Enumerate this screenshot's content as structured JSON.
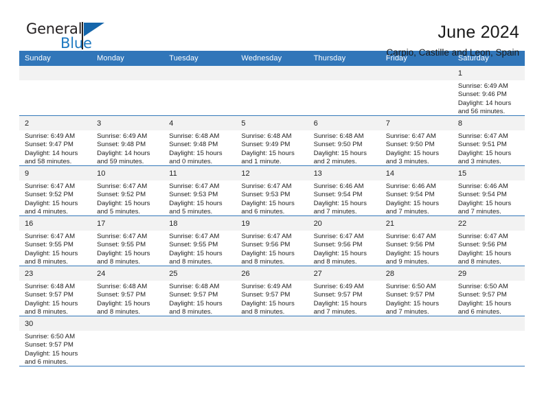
{
  "brand": {
    "name_part1": "General",
    "name_part2": "Blue",
    "flag_icon": "blue-flag-logo"
  },
  "header": {
    "title": "June 2024",
    "subtitle": "Carpio, Castille and Leon, Spain"
  },
  "calendar": {
    "weekday_headers": [
      "Sunday",
      "Monday",
      "Tuesday",
      "Wednesday",
      "Thursday",
      "Friday",
      "Saturday"
    ],
    "accent_color": "#3176b9",
    "daynum_band_color": "#f2f2f2",
    "labels": {
      "sunrise": "Sunrise:",
      "sunset": "Sunset:",
      "daylight": "Daylight:"
    },
    "weeks": [
      [
        {
          "day": "",
          "blank": true
        },
        {
          "day": "",
          "blank": true
        },
        {
          "day": "",
          "blank": true
        },
        {
          "day": "",
          "blank": true
        },
        {
          "day": "",
          "blank": true
        },
        {
          "day": "",
          "blank": true
        },
        {
          "day": "1",
          "sunrise": "Sunrise: 6:49 AM",
          "sunset": "Sunset: 9:46 PM",
          "daylight": "Daylight: 14 hours and 56 minutes."
        }
      ],
      [
        {
          "day": "2",
          "sunrise": "Sunrise: 6:49 AM",
          "sunset": "Sunset: 9:47 PM",
          "daylight": "Daylight: 14 hours and 58 minutes."
        },
        {
          "day": "3",
          "sunrise": "Sunrise: 6:49 AM",
          "sunset": "Sunset: 9:48 PM",
          "daylight": "Daylight: 14 hours and 59 minutes."
        },
        {
          "day": "4",
          "sunrise": "Sunrise: 6:48 AM",
          "sunset": "Sunset: 9:48 PM",
          "daylight": "Daylight: 15 hours and 0 minutes."
        },
        {
          "day": "5",
          "sunrise": "Sunrise: 6:48 AM",
          "sunset": "Sunset: 9:49 PM",
          "daylight": "Daylight: 15 hours and 1 minute."
        },
        {
          "day": "6",
          "sunrise": "Sunrise: 6:48 AM",
          "sunset": "Sunset: 9:50 PM",
          "daylight": "Daylight: 15 hours and 2 minutes."
        },
        {
          "day": "7",
          "sunrise": "Sunrise: 6:47 AM",
          "sunset": "Sunset: 9:50 PM",
          "daylight": "Daylight: 15 hours and 3 minutes."
        },
        {
          "day": "8",
          "sunrise": "Sunrise: 6:47 AM",
          "sunset": "Sunset: 9:51 PM",
          "daylight": "Daylight: 15 hours and 3 minutes."
        }
      ],
      [
        {
          "day": "9",
          "sunrise": "Sunrise: 6:47 AM",
          "sunset": "Sunset: 9:52 PM",
          "daylight": "Daylight: 15 hours and 4 minutes."
        },
        {
          "day": "10",
          "sunrise": "Sunrise: 6:47 AM",
          "sunset": "Sunset: 9:52 PM",
          "daylight": "Daylight: 15 hours and 5 minutes."
        },
        {
          "day": "11",
          "sunrise": "Sunrise: 6:47 AM",
          "sunset": "Sunset: 9:53 PM",
          "daylight": "Daylight: 15 hours and 5 minutes."
        },
        {
          "day": "12",
          "sunrise": "Sunrise: 6:47 AM",
          "sunset": "Sunset: 9:53 PM",
          "daylight": "Daylight: 15 hours and 6 minutes."
        },
        {
          "day": "13",
          "sunrise": "Sunrise: 6:46 AM",
          "sunset": "Sunset: 9:54 PM",
          "daylight": "Daylight: 15 hours and 7 minutes."
        },
        {
          "day": "14",
          "sunrise": "Sunrise: 6:46 AM",
          "sunset": "Sunset: 9:54 PM",
          "daylight": "Daylight: 15 hours and 7 minutes."
        },
        {
          "day": "15",
          "sunrise": "Sunrise: 6:46 AM",
          "sunset": "Sunset: 9:54 PM",
          "daylight": "Daylight: 15 hours and 7 minutes."
        }
      ],
      [
        {
          "day": "16",
          "sunrise": "Sunrise: 6:47 AM",
          "sunset": "Sunset: 9:55 PM",
          "daylight": "Daylight: 15 hours and 8 minutes."
        },
        {
          "day": "17",
          "sunrise": "Sunrise: 6:47 AM",
          "sunset": "Sunset: 9:55 PM",
          "daylight": "Daylight: 15 hours and 8 minutes."
        },
        {
          "day": "18",
          "sunrise": "Sunrise: 6:47 AM",
          "sunset": "Sunset: 9:55 PM",
          "daylight": "Daylight: 15 hours and 8 minutes."
        },
        {
          "day": "19",
          "sunrise": "Sunrise: 6:47 AM",
          "sunset": "Sunset: 9:56 PM",
          "daylight": "Daylight: 15 hours and 8 minutes."
        },
        {
          "day": "20",
          "sunrise": "Sunrise: 6:47 AM",
          "sunset": "Sunset: 9:56 PM",
          "daylight": "Daylight: 15 hours and 8 minutes."
        },
        {
          "day": "21",
          "sunrise": "Sunrise: 6:47 AM",
          "sunset": "Sunset: 9:56 PM",
          "daylight": "Daylight: 15 hours and 9 minutes."
        },
        {
          "day": "22",
          "sunrise": "Sunrise: 6:47 AM",
          "sunset": "Sunset: 9:56 PM",
          "daylight": "Daylight: 15 hours and 8 minutes."
        }
      ],
      [
        {
          "day": "23",
          "sunrise": "Sunrise: 6:48 AM",
          "sunset": "Sunset: 9:57 PM",
          "daylight": "Daylight: 15 hours and 8 minutes."
        },
        {
          "day": "24",
          "sunrise": "Sunrise: 6:48 AM",
          "sunset": "Sunset: 9:57 PM",
          "daylight": "Daylight: 15 hours and 8 minutes."
        },
        {
          "day": "25",
          "sunrise": "Sunrise: 6:48 AM",
          "sunset": "Sunset: 9:57 PM",
          "daylight": "Daylight: 15 hours and 8 minutes."
        },
        {
          "day": "26",
          "sunrise": "Sunrise: 6:49 AM",
          "sunset": "Sunset: 9:57 PM",
          "daylight": "Daylight: 15 hours and 8 minutes."
        },
        {
          "day": "27",
          "sunrise": "Sunrise: 6:49 AM",
          "sunset": "Sunset: 9:57 PM",
          "daylight": "Daylight: 15 hours and 7 minutes."
        },
        {
          "day": "28",
          "sunrise": "Sunrise: 6:50 AM",
          "sunset": "Sunset: 9:57 PM",
          "daylight": "Daylight: 15 hours and 7 minutes."
        },
        {
          "day": "29",
          "sunrise": "Sunrise: 6:50 AM",
          "sunset": "Sunset: 9:57 PM",
          "daylight": "Daylight: 15 hours and 6 minutes."
        }
      ],
      [
        {
          "day": "30",
          "sunrise": "Sunrise: 6:50 AM",
          "sunset": "Sunset: 9:57 PM",
          "daylight": "Daylight: 15 hours and 6 minutes."
        },
        {
          "day": "",
          "blank": true
        },
        {
          "day": "",
          "blank": true
        },
        {
          "day": "",
          "blank": true
        },
        {
          "day": "",
          "blank": true
        },
        {
          "day": "",
          "blank": true
        },
        {
          "day": "",
          "blank": true
        }
      ]
    ]
  }
}
